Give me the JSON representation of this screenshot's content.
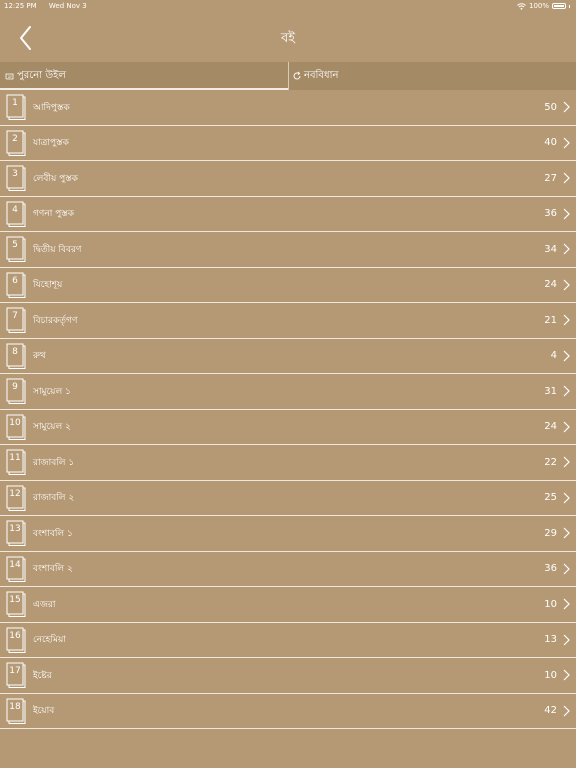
{
  "status": {
    "time": "12:25 PM",
    "date": "Wed Nov 3",
    "battery": "100%"
  },
  "nav": {
    "title": "বই"
  },
  "tabs": {
    "old": "পুরনো উইল",
    "new": "নববিধান"
  },
  "books": [
    {
      "num": "1",
      "name": "আদিপুস্তক",
      "count": "50"
    },
    {
      "num": "2",
      "name": "যাত্রাপুস্তক",
      "count": "40"
    },
    {
      "num": "3",
      "name": "লেবীয় পুস্তক",
      "count": "27"
    },
    {
      "num": "4",
      "name": "গণনা পুস্তক",
      "count": "36"
    },
    {
      "num": "5",
      "name": "দ্বিতীয় বিবরণ",
      "count": "34"
    },
    {
      "num": "6",
      "name": "যিহোশূয়",
      "count": "24"
    },
    {
      "num": "7",
      "name": "বিচারকর্তৃগণ",
      "count": "21"
    },
    {
      "num": "8",
      "name": "রুথ",
      "count": "4"
    },
    {
      "num": "9",
      "name": "সামুয়েল ১",
      "count": "31"
    },
    {
      "num": "10",
      "name": "সামুয়েল ২",
      "count": "24"
    },
    {
      "num": "11",
      "name": "রাজাবলি ১",
      "count": "22"
    },
    {
      "num": "12",
      "name": "রাজাবলি ২",
      "count": "25"
    },
    {
      "num": "13",
      "name": "বংশাবলি ১",
      "count": "29"
    },
    {
      "num": "14",
      "name": "বংশাবলি ২",
      "count": "36"
    },
    {
      "num": "15",
      "name": "এজরা",
      "count": "10"
    },
    {
      "num": "16",
      "name": "নেহেমিয়া",
      "count": "13"
    },
    {
      "num": "17",
      "name": "ইষ্টের",
      "count": "10"
    },
    {
      "num": "18",
      "name": "ইয়োব",
      "count": "42"
    }
  ]
}
